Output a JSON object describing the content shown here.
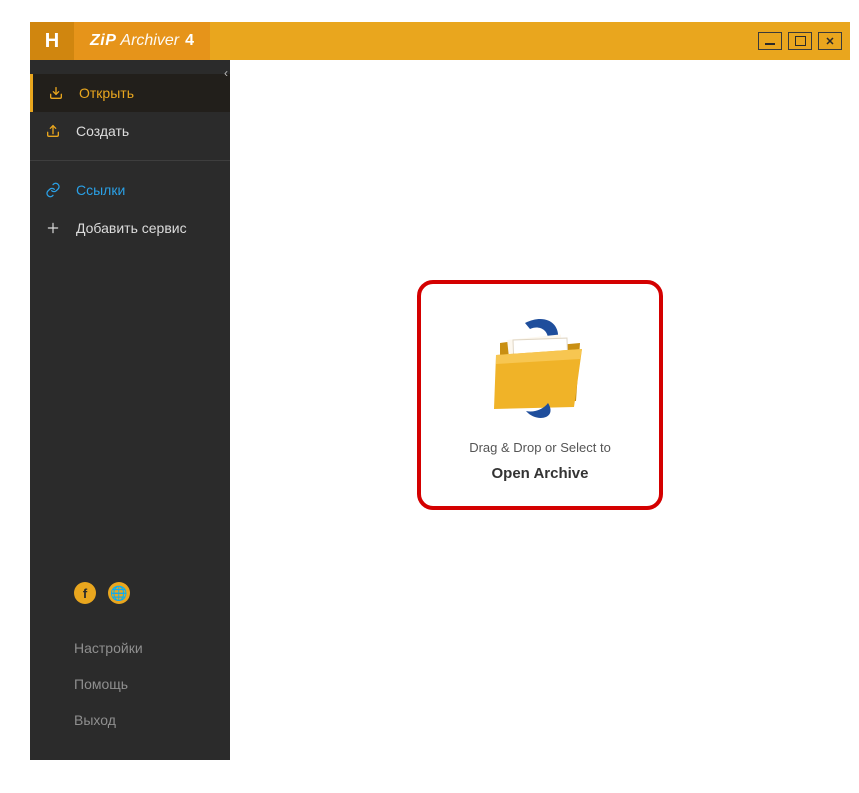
{
  "title": {
    "brand": "ZiP",
    "suffix": "Archiver",
    "version": "4",
    "logo_letter": "H"
  },
  "window_controls": {
    "close_glyph": "✕"
  },
  "sidebar": {
    "collapse_glyph": "‹",
    "items": {
      "open": {
        "label": "Открыть"
      },
      "create": {
        "label": "Создать"
      },
      "links": {
        "label": "Ссылки"
      },
      "addsvc": {
        "label": "Добавить сервис"
      }
    },
    "social": {
      "fb": "f",
      "web": "🌐"
    },
    "footer": {
      "settings": "Настройки",
      "help": "Помощь",
      "exit": "Выход"
    }
  },
  "main": {
    "drop_line1": "Drag & Drop or Select to",
    "drop_line2": "Open Archive"
  }
}
